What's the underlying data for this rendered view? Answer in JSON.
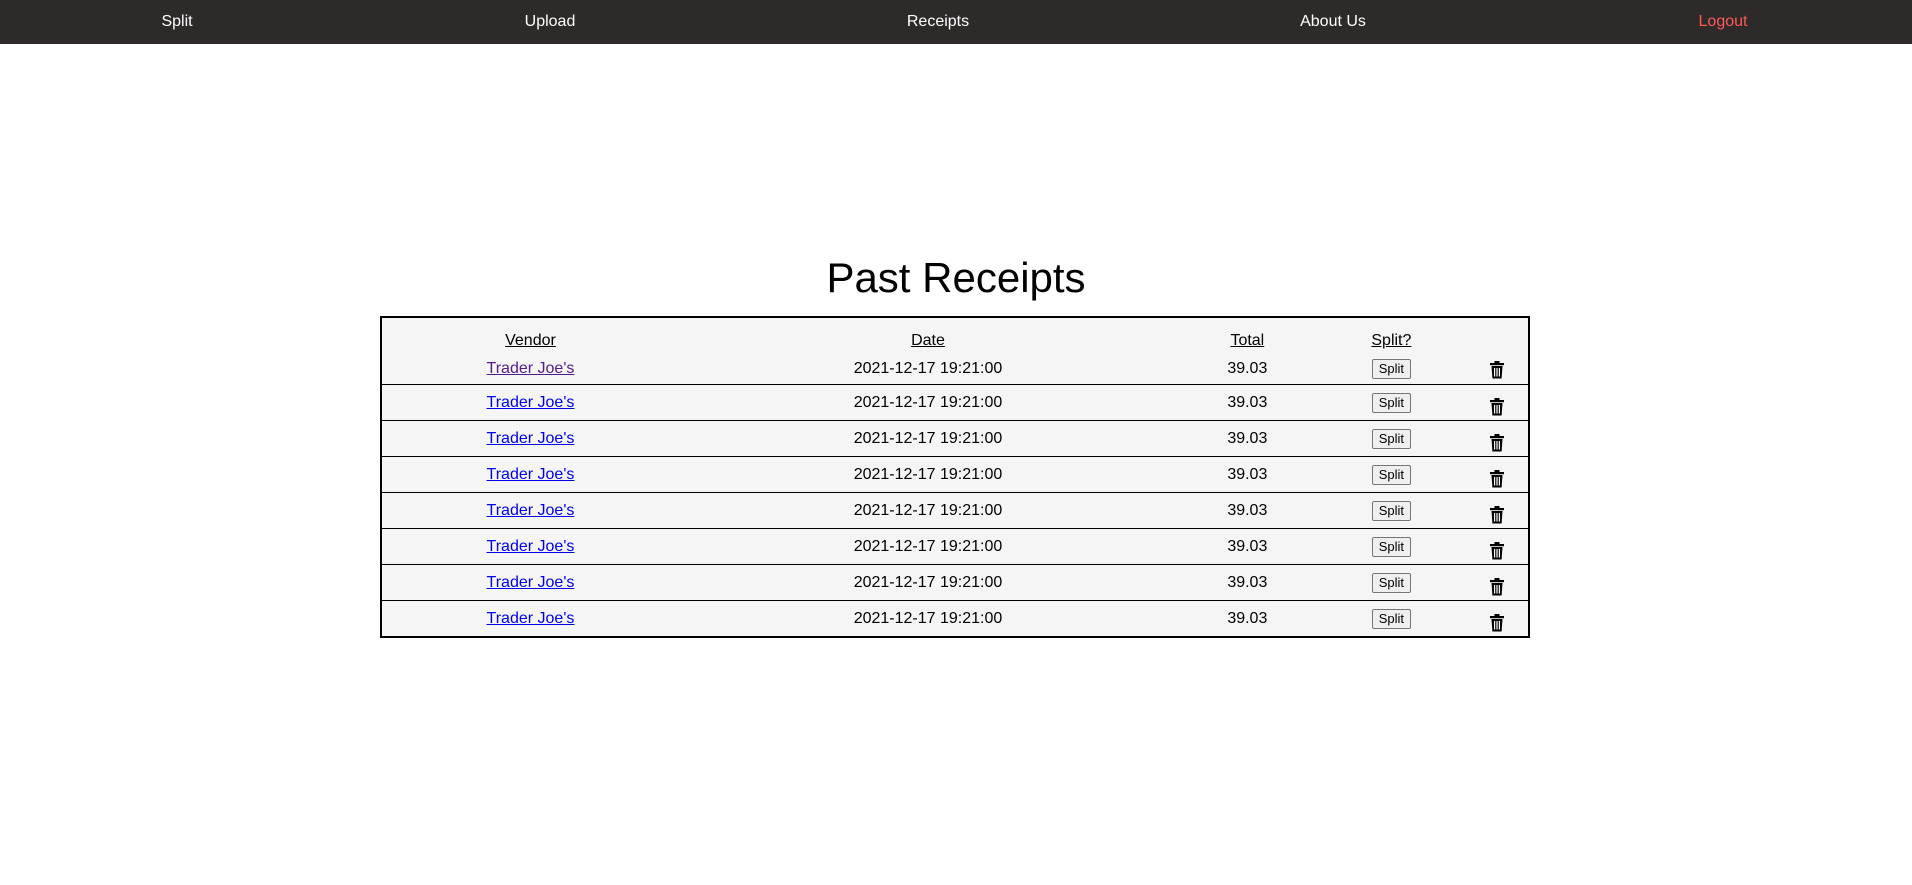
{
  "nav": {
    "items": [
      {
        "label": "Split"
      },
      {
        "label": "Upload"
      },
      {
        "label": "Receipts"
      },
      {
        "label": "About Us"
      },
      {
        "label": "Logout"
      }
    ]
  },
  "colors": {
    "navbar_bg": "#2e2a29",
    "logout": "#ff5a5a",
    "link": "#0000ee",
    "link_visited": "#551a8b",
    "table_bg": "#f5f5f5"
  },
  "page": {
    "title": "Past Receipts"
  },
  "table": {
    "headers": {
      "vendor": "Vendor",
      "date": "Date",
      "total": "Total",
      "split": "Split?"
    },
    "split_button_label": "Split",
    "delete_icon": "trash-icon",
    "rows": [
      {
        "vendor": "Trader Joe's",
        "date": "2021-12-17 19:21:00",
        "total": "39.03",
        "visited": true
      },
      {
        "vendor": "Trader Joe's",
        "date": "2021-12-17 19:21:00",
        "total": "39.03",
        "visited": false
      },
      {
        "vendor": "Trader Joe's",
        "date": "2021-12-17 19:21:00",
        "total": "39.03",
        "visited": false
      },
      {
        "vendor": "Trader Joe's",
        "date": "2021-12-17 19:21:00",
        "total": "39.03",
        "visited": false
      },
      {
        "vendor": "Trader Joe's",
        "date": "2021-12-17 19:21:00",
        "total": "39.03",
        "visited": false
      },
      {
        "vendor": "Trader Joe's",
        "date": "2021-12-17 19:21:00",
        "total": "39.03",
        "visited": false
      },
      {
        "vendor": "Trader Joe's",
        "date": "2021-12-17 19:21:00",
        "total": "39.03",
        "visited": false
      },
      {
        "vendor": "Trader Joe's",
        "date": "2021-12-17 19:21:00",
        "total": "39.03",
        "visited": false
      }
    ]
  }
}
